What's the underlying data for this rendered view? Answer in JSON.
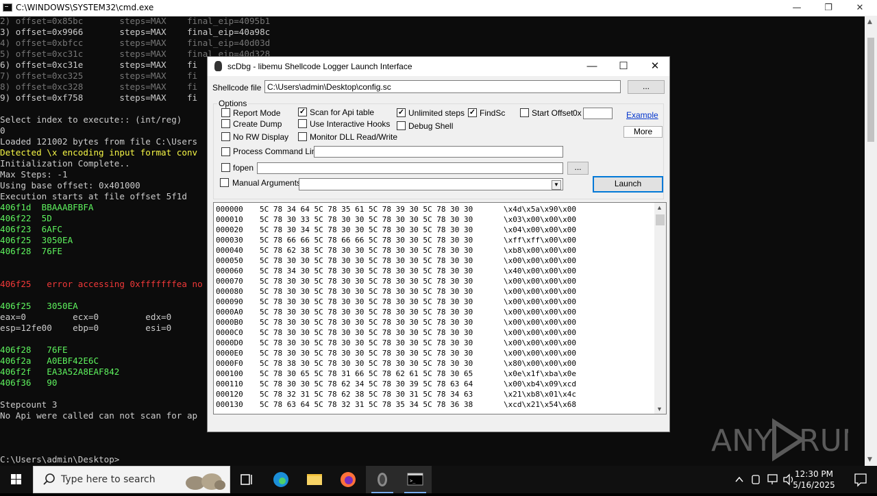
{
  "cmd": {
    "title": "C:\\WINDOWS\\SYSTEM32\\cmd.exe",
    "lines": [
      {
        "t": "2) offset=0x85bc       steps=MAX    final_eip=4095b1",
        "c": "d"
      },
      {
        "t": "3) offset=0x9966       steps=MAX    final_eip=40a98c",
        "c": "w"
      },
      {
        "t": "4) offset=0xbfcc       steps=MAX    final_eip=40d03d",
        "c": "d"
      },
      {
        "t": "5) offset=0xc31c       steps=MAX    final_eip=40d328",
        "c": "d"
      },
      {
        "t": "6) offset=0xc31e       steps=MAX    fi",
        "c": "w"
      },
      {
        "t": "7) offset=0xc325       steps=MAX    fi",
        "c": "d"
      },
      {
        "t": "8) offset=0xc328       steps=MAX    fi",
        "c": "d"
      },
      {
        "t": "9) offset=0xf758       steps=MAX    fi",
        "c": "w"
      },
      {
        "t": "",
        "c": "w"
      },
      {
        "t": "Select index to execute:: (int/reg)",
        "c": "w"
      },
      {
        "t": "0",
        "c": "w"
      },
      {
        "t": "Loaded 121002 bytes from file C:\\Users",
        "c": "w"
      },
      {
        "t": "Detected \\x encoding input format conv",
        "c": "y"
      },
      {
        "t": "Initialization Complete..",
        "c": "w"
      },
      {
        "t": "Max Steps: -1",
        "c": "w"
      },
      {
        "t": "Using base offset: 0x401000",
        "c": "w"
      },
      {
        "t": "Execution starts at file offset 5f1d",
        "c": "w"
      },
      {
        "t": "406f1d  BBAAABFBFA",
        "c": "g"
      },
      {
        "t": "406f22  5D",
        "c": "g"
      },
      {
        "t": "406f23  6AFC",
        "c": "g"
      },
      {
        "t": "406f25  3050EA",
        "c": "g"
      },
      {
        "t": "406f28  76FE",
        "c": "g"
      },
      {
        "t": "",
        "c": "w"
      },
      {
        "t": "",
        "c": "w"
      },
      {
        "t": "406f25   error accessing 0xfffffffea no",
        "c": "r"
      },
      {
        "t": "",
        "c": "w"
      },
      {
        "t": "406f25   3050EA",
        "c": "g"
      },
      {
        "t": "eax=0         ecx=0         edx=0",
        "c": "w"
      },
      {
        "t": "esp=12fe00    ebp=0         esi=0",
        "c": "w"
      },
      {
        "t": "",
        "c": "w"
      },
      {
        "t": "406f28   76FE",
        "c": "g"
      },
      {
        "t": "406f2a   A0EBF42E6C",
        "c": "g"
      },
      {
        "t": "406f2f   EA3A52A8EAF842",
        "c": "g"
      },
      {
        "t": "406f36   90",
        "c": "g"
      },
      {
        "t": "",
        "c": "w"
      },
      {
        "t": "Stepcount 3",
        "c": "w"
      },
      {
        "t": "No Api were called can not scan for ap",
        "c": "w"
      },
      {
        "t": "",
        "c": "w"
      },
      {
        "t": "",
        "c": "w"
      },
      {
        "t": "",
        "c": "w"
      },
      {
        "t": "C:\\Users\\admin\\Desktop>",
        "c": "w"
      }
    ]
  },
  "scdbg": {
    "title": "scDbg - libemu Shellcode Logger Launch Interface",
    "shellcode_label": "Shellcode file",
    "shellcode_path": "C:\\Users\\admin\\Desktop\\config.sc",
    "browse_label": "...",
    "options_label": "Options",
    "opt": {
      "report_mode": "Report Mode",
      "create_dump": "Create Dump",
      "no_rw_display": "No RW Display",
      "scan_api": "Scan for Api table",
      "interactive_hooks": "Use Interactive Hooks",
      "monitor_dll": "Monitor DLL Read/Write",
      "unlimited_steps": "Unlimited steps",
      "debug_shell": "Debug Shell",
      "findsc": "FindSc",
      "start_offset": "Start Offset",
      "hex_prefix": "0x",
      "process_cmd": "Process Command Line",
      "fopen": "fopen",
      "manual_args": "Manual  Arguments"
    },
    "checked_mark": "✓",
    "example_label": "Example",
    "more_label": "More",
    "launch_label": "Launch",
    "hex_rows": [
      [
        "000000",
        "5C 78 34 64 5C 78 35 61 5C 78 39 30 5C 78 30 30",
        "\\x4d\\x5a\\x90\\x00"
      ],
      [
        "000010",
        "5C 78 30 33 5C 78 30 30 5C 78 30 30 5C 78 30 30",
        "\\x03\\x00\\x00\\x00"
      ],
      [
        "000020",
        "5C 78 30 34 5C 78 30 30 5C 78 30 30 5C 78 30 30",
        "\\x04\\x00\\x00\\x00"
      ],
      [
        "000030",
        "5C 78 66 66 5C 78 66 66 5C 78 30 30 5C 78 30 30",
        "\\xff\\xff\\x00\\x00"
      ],
      [
        "000040",
        "5C 78 62 38 5C 78 30 30 5C 78 30 30 5C 78 30 30",
        "\\xb8\\x00\\x00\\x00"
      ],
      [
        "000050",
        "5C 78 30 30 5C 78 30 30 5C 78 30 30 5C 78 30 30",
        "\\x00\\x00\\x00\\x00"
      ],
      [
        "000060",
        "5C 78 34 30 5C 78 30 30 5C 78 30 30 5C 78 30 30",
        "\\x40\\x00\\x00\\x00"
      ],
      [
        "000070",
        "5C 78 30 30 5C 78 30 30 5C 78 30 30 5C 78 30 30",
        "\\x00\\x00\\x00\\x00"
      ],
      [
        "000080",
        "5C 78 30 30 5C 78 30 30 5C 78 30 30 5C 78 30 30",
        "\\x00\\x00\\x00\\x00"
      ],
      [
        "000090",
        "5C 78 30 30 5C 78 30 30 5C 78 30 30 5C 78 30 30",
        "\\x00\\x00\\x00\\x00"
      ],
      [
        "0000A0",
        "5C 78 30 30 5C 78 30 30 5C 78 30 30 5C 78 30 30",
        "\\x00\\x00\\x00\\x00"
      ],
      [
        "0000B0",
        "5C 78 30 30 5C 78 30 30 5C 78 30 30 5C 78 30 30",
        "\\x00\\x00\\x00\\x00"
      ],
      [
        "0000C0",
        "5C 78 30 30 5C 78 30 30 5C 78 30 30 5C 78 30 30",
        "\\x00\\x00\\x00\\x00"
      ],
      [
        "0000D0",
        "5C 78 30 30 5C 78 30 30 5C 78 30 30 5C 78 30 30",
        "\\x00\\x00\\x00\\x00"
      ],
      [
        "0000E0",
        "5C 78 30 30 5C 78 30 30 5C 78 30 30 5C 78 30 30",
        "\\x00\\x00\\x00\\x00"
      ],
      [
        "0000F0",
        "5C 78 38 30 5C 78 30 30 5C 78 30 30 5C 78 30 30",
        "\\x80\\x00\\x00\\x00"
      ],
      [
        "000100",
        "5C 78 30 65 5C 78 31 66 5C 78 62 61 5C 78 30 65",
        "\\x0e\\x1f\\xba\\x0e"
      ],
      [
        "000110",
        "5C 78 30 30 5C 78 62 34 5C 78 30 39 5C 78 63 64",
        "\\x00\\xb4\\x09\\xcd"
      ],
      [
        "000120",
        "5C 78 32 31 5C 78 62 38 5C 78 30 31 5C 78 34 63",
        "\\x21\\xb8\\x01\\x4c"
      ],
      [
        "000130",
        "5C 78 63 64 5C 78 32 31 5C 78 35 34 5C 78 36 38",
        "\\xcd\\x21\\x54\\x68"
      ]
    ]
  },
  "watermark": "ANY RUN",
  "taskbar": {
    "search_placeholder": "Type here to search",
    "time": "12:30 PM",
    "date": "5/16/2025"
  },
  "colors": {
    "console_bg": "#0c0c0c",
    "console_green": "#5ef35e",
    "console_yellow": "#f6f646",
    "console_red": "#f03838",
    "dialog_bg": "#f0f0f0",
    "link": "#0033cc"
  }
}
